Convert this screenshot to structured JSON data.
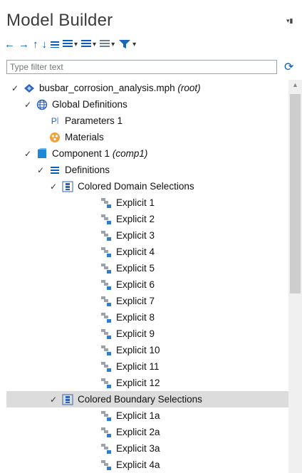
{
  "panel": {
    "title": "Model Builder"
  },
  "filter": {
    "placeholder": "Type filter text"
  },
  "tree": {
    "root": {
      "name": "busbar_corrosion_analysis.mph",
      "tag": "(root)"
    },
    "global_definitions": "Global Definitions",
    "parameters": "Parameters 1",
    "materials": "Materials",
    "component": {
      "name": "Component 1",
      "tag": "(comp1)"
    },
    "definitions": "Definitions",
    "domain_selections": "Colored Domain Selections",
    "domain_items": [
      "Explicit 1",
      "Explicit 2",
      "Explicit 3",
      "Explicit 4",
      "Explicit 5",
      "Explicit 6",
      "Explicit 7",
      "Explicit 8",
      "Explicit 9",
      "Explicit 10",
      "Explicit 11",
      "Explicit 12"
    ],
    "boundary_selections": "Colored Boundary Selections",
    "boundary_items": [
      "Explicit 1a",
      "Explicit 2a",
      "Explicit 3a",
      "Explicit 4a"
    ]
  }
}
